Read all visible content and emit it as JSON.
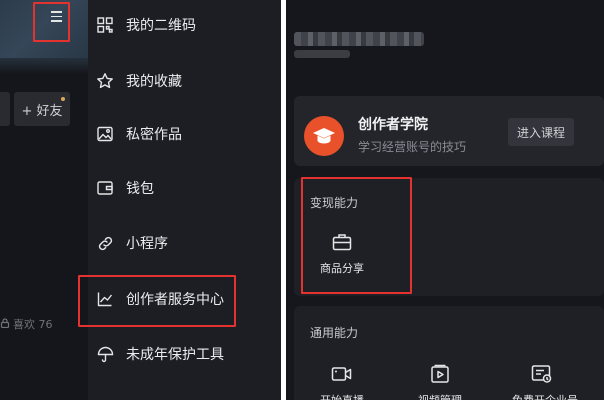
{
  "left": {
    "menu_icon": "hamburger-menu-icon",
    "add_friend_label": "+ 好友",
    "likes_text": "喜欢 76",
    "menu": [
      {
        "label": "我的二维码",
        "icon": "qr-code-icon"
      },
      {
        "label": "我的收藏",
        "icon": "star-icon"
      },
      {
        "label": "私密作品",
        "icon": "image-icon"
      },
      {
        "label": "钱包",
        "icon": "wallet-icon"
      },
      {
        "label": "小程序",
        "icon": "link-icon"
      },
      {
        "label": "创作者服务中心",
        "icon": "chart-icon"
      },
      {
        "label": "未成年保护工具",
        "icon": "umbrella-icon"
      }
    ]
  },
  "right": {
    "academy": {
      "title": "创作者学院",
      "subtitle": "学习经营账号的技巧",
      "button": "进入课程",
      "icon": "graduation-cap-icon"
    },
    "monetization": {
      "title": "变现能力",
      "items": [
        {
          "label": "商品分享",
          "icon": "briefcase-icon"
        }
      ]
    },
    "general": {
      "title": "通用能力",
      "items": [
        {
          "label": "开始直播",
          "icon": "video-camera-icon"
        },
        {
          "label": "视频管理",
          "icon": "video-play-icon"
        },
        {
          "label": "免费开企业号",
          "icon": "enterprise-icon"
        }
      ]
    }
  },
  "colors": {
    "highlight": "#e4322e",
    "academy_accent": "#e9512b",
    "background": "#16171c",
    "drawer": "#1d1e24"
  }
}
